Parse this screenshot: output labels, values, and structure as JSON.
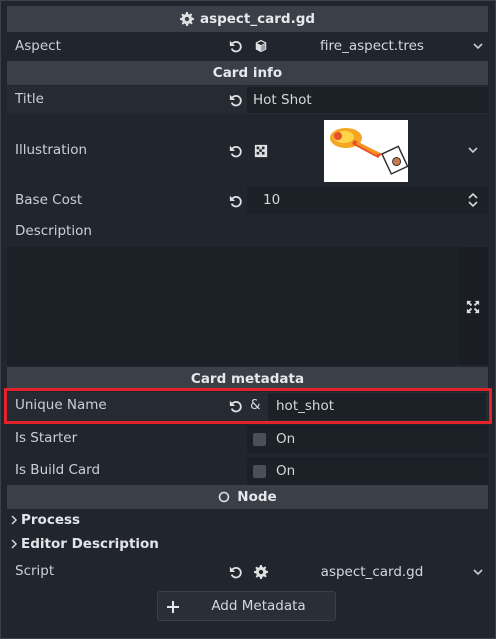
{
  "header": {
    "title": "aspect_card.gd"
  },
  "aspect_row": {
    "label": "Aspect",
    "value": "fire_aspect.tres"
  },
  "sections": {
    "card_info": "Card info",
    "card_metadata": "Card metadata",
    "node": "Node"
  },
  "card_info": {
    "title": {
      "label": "Title",
      "value": "Hot Shot"
    },
    "illustration": {
      "label": "Illustration"
    },
    "base_cost": {
      "label": "Base Cost",
      "value": "10"
    },
    "description": {
      "label": "Description",
      "value": ""
    }
  },
  "card_metadata": {
    "unique_name": {
      "label": "Unique Name",
      "prefix": "&",
      "value": "hot_shot"
    },
    "is_starter": {
      "label": "Is Starter",
      "value": "On"
    },
    "is_build_card": {
      "label": "Is Build Card",
      "value": "On"
    }
  },
  "node": {
    "groups": [
      "Process",
      "Editor Description"
    ],
    "script": {
      "label": "Script",
      "value": "aspect_card.gd"
    }
  },
  "add_metadata": {
    "label": "Add Metadata"
  },
  "colors": {
    "highlight": "#e2232a",
    "section_bg": "#3a3f48",
    "panel_bg": "#21262e"
  },
  "icons": [
    "gear-icon",
    "revert-icon",
    "cube-icon",
    "chevron-down-icon",
    "texture-icon",
    "spinner-icon",
    "expand-icon",
    "node-circle-icon",
    "chevron-right-icon",
    "plus-icon"
  ]
}
